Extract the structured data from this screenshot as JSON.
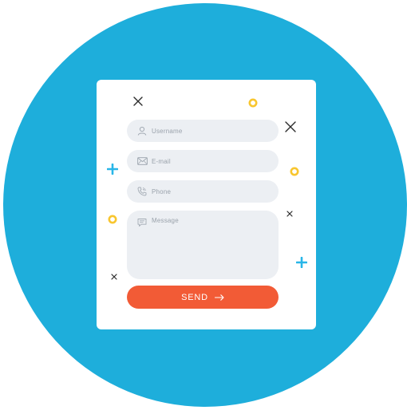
{
  "form": {
    "username_placeholder": "Username",
    "email_placeholder": "E-mail",
    "phone_placeholder": "Phone",
    "message_placeholder": "Message",
    "send_label": "SEND"
  },
  "icons": {
    "username": "user-icon",
    "email": "envelope-icon",
    "phone": "phone-icon",
    "message": "chat-icon",
    "send": "arrow-right-icon"
  },
  "colors": {
    "background_circle": "#1eaedb",
    "card": "#ffffff",
    "field": "#eceff3",
    "send_button": "#f25b36",
    "accent_yellow": "#f8c62f",
    "accent_blue": "#29b6e8",
    "cross_dark": "#2b2b2b"
  }
}
